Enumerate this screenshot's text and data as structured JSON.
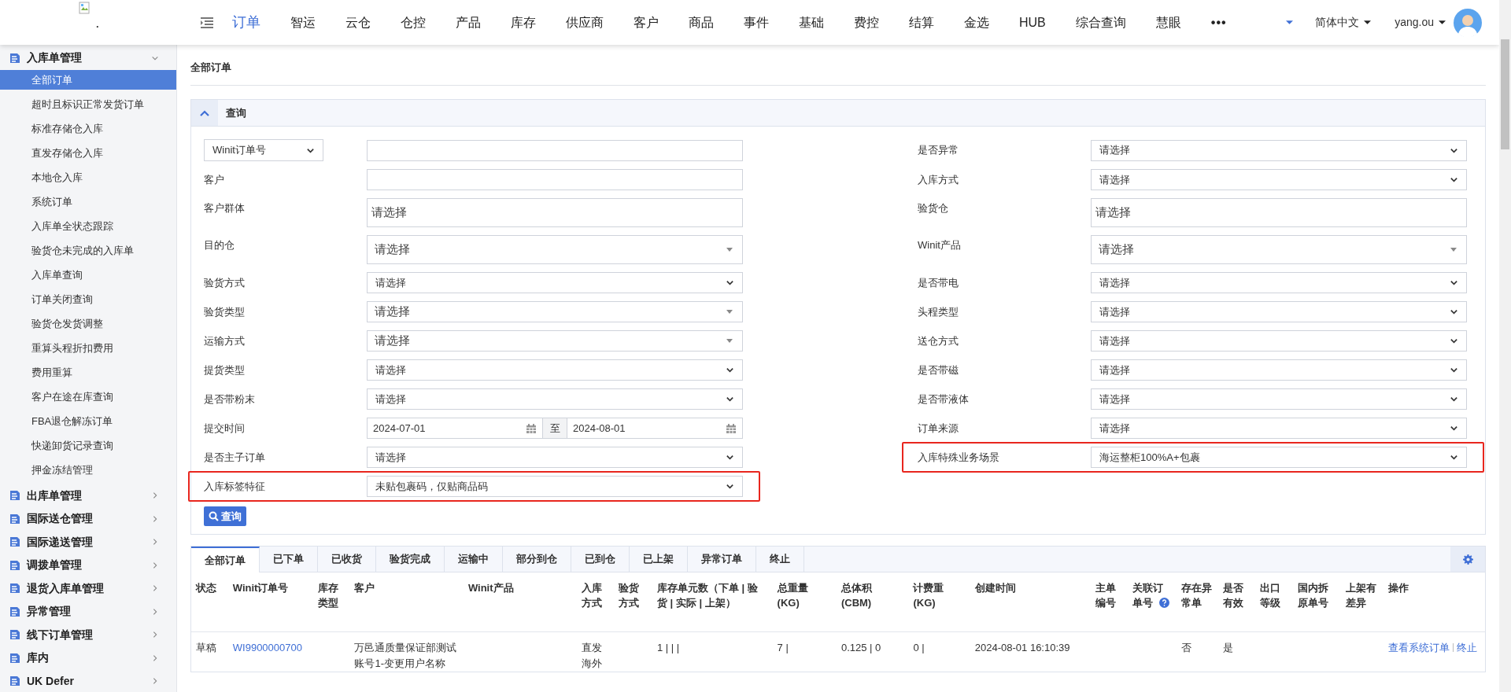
{
  "header": {
    "logo_alt": ".",
    "nav": [
      {
        "label": "订单",
        "selected": true
      },
      {
        "label": "智运",
        "selected": false
      },
      {
        "label": "云仓",
        "selected": false
      },
      {
        "label": "仓控",
        "selected": false
      },
      {
        "label": "产品",
        "selected": false
      },
      {
        "label": "库存",
        "selected": false
      },
      {
        "label": "供应商",
        "selected": false
      },
      {
        "label": "客户",
        "selected": false
      },
      {
        "label": "商品",
        "selected": false
      },
      {
        "label": "事件",
        "selected": false
      },
      {
        "label": "基础",
        "selected": false
      },
      {
        "label": "费控",
        "selected": false
      },
      {
        "label": "结算",
        "selected": false
      },
      {
        "label": "金选",
        "selected": false
      },
      {
        "label": "HUB",
        "selected": false
      },
      {
        "label": "综合查询",
        "selected": false
      },
      {
        "label": "慧眼",
        "selected": false
      }
    ],
    "more": "•••",
    "language": "简体中文",
    "user": "yang.ou"
  },
  "sidebar": {
    "groups": [
      {
        "label": "入库单管理",
        "expanded": true,
        "children": [
          {
            "label": "全部订单",
            "selected": true
          },
          {
            "label": "超时且标识正常发货订单",
            "selected": false
          },
          {
            "label": "标准存储仓入库",
            "selected": false
          },
          {
            "label": "直发存储仓入库",
            "selected": false
          },
          {
            "label": "本地仓入库",
            "selected": false
          },
          {
            "label": "系统订单",
            "selected": false
          },
          {
            "label": "入库单全状态跟踪",
            "selected": false
          },
          {
            "label": "验货仓未完成的入库单",
            "selected": false
          },
          {
            "label": "入库单查询",
            "selected": false
          },
          {
            "label": "订单关闭查询",
            "selected": false
          },
          {
            "label": "验货仓发货调整",
            "selected": false
          },
          {
            "label": "重算头程折扣费用",
            "selected": false
          },
          {
            "label": "费用重算",
            "selected": false
          },
          {
            "label": "客户在途在库查询",
            "selected": false
          },
          {
            "label": "FBA退仓解冻订单",
            "selected": false
          },
          {
            "label": "快递卸货记录查询",
            "selected": false
          },
          {
            "label": "押金冻结管理",
            "selected": false
          }
        ]
      },
      {
        "label": "出库单管理",
        "expanded": false
      },
      {
        "label": "国际送仓管理",
        "expanded": false
      },
      {
        "label": "国际递送管理",
        "expanded": false
      },
      {
        "label": "调拨单管理",
        "expanded": false
      },
      {
        "label": "退货入库单管理",
        "expanded": false
      },
      {
        "label": "异常管理",
        "expanded": false
      },
      {
        "label": "线下订单管理",
        "expanded": false
      },
      {
        "label": "库内",
        "expanded": false
      },
      {
        "label": "UK Defer",
        "expanded": false
      }
    ]
  },
  "breadcrumb": "全部订单",
  "query": {
    "title": "查询",
    "expanded": true,
    "left_fields": [
      {
        "kind": "keyed_text",
        "key": "Winit订单号",
        "highlighted": false
      },
      {
        "kind": "text",
        "label": "客户",
        "highlighted": false
      },
      {
        "kind": "multi",
        "label": "客户群体",
        "placeholder": "请选择",
        "highlighted": false
      },
      {
        "kind": "combo",
        "label": "目的仓",
        "placeholder": "请选择",
        "tall": true,
        "highlighted": false
      },
      {
        "kind": "select",
        "label": "验货方式",
        "value": "请选择",
        "highlighted": false
      },
      {
        "kind": "combo",
        "label": "验货类型",
        "placeholder": "请选择",
        "highlighted": false
      },
      {
        "kind": "combo",
        "label": "运输方式",
        "placeholder": "请选择",
        "highlighted": false
      },
      {
        "kind": "select",
        "label": "提货类型",
        "value": "请选择",
        "highlighted": false
      },
      {
        "kind": "select",
        "label": "是否带粉末",
        "value": "请选择",
        "highlighted": false
      },
      {
        "kind": "daterange",
        "label": "提交时间",
        "from": "2024-07-01",
        "separator": "至",
        "to": "2024-08-01",
        "highlighted": false
      },
      {
        "kind": "select",
        "label": "是否主子订单",
        "value": "请选择",
        "highlighted": false
      },
      {
        "kind": "select",
        "label": "入库标签特征",
        "value": "未贴包裹码，仅贴商品码",
        "highlighted": true
      }
    ],
    "right_fields": [
      {
        "kind": "select",
        "label": "是否异常",
        "value": "请选择",
        "highlighted": false
      },
      {
        "kind": "select",
        "label": "入库方式",
        "value": "请选择",
        "highlighted": false
      },
      {
        "kind": "multi",
        "label": "验货仓",
        "placeholder": "请选择",
        "highlighted": false
      },
      {
        "kind": "combo",
        "label": "Winit产品",
        "placeholder": "请选择",
        "tall": true,
        "highlighted": false
      },
      {
        "kind": "select",
        "label": "是否带电",
        "value": "请选择",
        "highlighted": false
      },
      {
        "kind": "select",
        "label": "头程类型",
        "value": "请选择",
        "highlighted": false
      },
      {
        "kind": "select",
        "label": "送仓方式",
        "value": "请选择",
        "highlighted": false
      },
      {
        "kind": "select",
        "label": "是否带磁",
        "value": "请选择",
        "highlighted": false
      },
      {
        "kind": "select",
        "label": "是否带液体",
        "value": "请选择",
        "highlighted": false
      },
      {
        "kind": "select",
        "label": "订单来源",
        "value": "请选择",
        "highlighted": false
      },
      {
        "kind": "select",
        "label": "入库特殊业务场景",
        "value": "海运整柜100%A+包裹",
        "highlighted": true
      }
    ],
    "button": "查询"
  },
  "tabs": [
    {
      "label": "全部订单",
      "selected": true
    },
    {
      "label": "已下单",
      "selected": false
    },
    {
      "label": "已收货",
      "selected": false
    },
    {
      "label": "验货完成",
      "selected": false
    },
    {
      "label": "运输中",
      "selected": false
    },
    {
      "label": "部分到仓",
      "selected": false
    },
    {
      "label": "已到仓",
      "selected": false
    },
    {
      "label": "已上架",
      "selected": false
    },
    {
      "label": "异常订单",
      "selected": false
    },
    {
      "label": "终止",
      "selected": false
    }
  ],
  "table": {
    "columns": [
      {
        "label": "状态"
      },
      {
        "label": "Winit订单号"
      },
      {
        "label": "库存类型"
      },
      {
        "label": "客户"
      },
      {
        "label": "Winit产品"
      },
      {
        "label": "入库方式"
      },
      {
        "label": "验货方式"
      },
      {
        "label": "库存单元数（下单 | 验货 | 实际 | 上架）"
      },
      {
        "label": "总重量 (KG)"
      },
      {
        "label": "总体积 (CBM)"
      },
      {
        "label": "计费重 (KG)"
      },
      {
        "label": "创建时间"
      },
      {
        "label": "主单编号"
      },
      {
        "label": "关联订单号",
        "help": true
      },
      {
        "label": "存在异常单"
      },
      {
        "label": "是否有效"
      },
      {
        "label": "出口等级"
      },
      {
        "label": "国内拆原单号"
      },
      {
        "label": "上架有差异"
      },
      {
        "label": "操作"
      }
    ],
    "rows": [
      {
        "cells": [
          "草稿",
          "WI9900000700",
          "",
          "万邑通质量保证部测试账号1-变更用户名称",
          "",
          "直发海外",
          "",
          "1 | | |",
          "7 |",
          "0.125 | 0",
          "0 |",
          "2024-08-01 16:10:39",
          "",
          "",
          "否",
          "是",
          "",
          "",
          ""
        ],
        "actions": [
          "查看系统订单",
          "终止"
        ]
      }
    ]
  }
}
